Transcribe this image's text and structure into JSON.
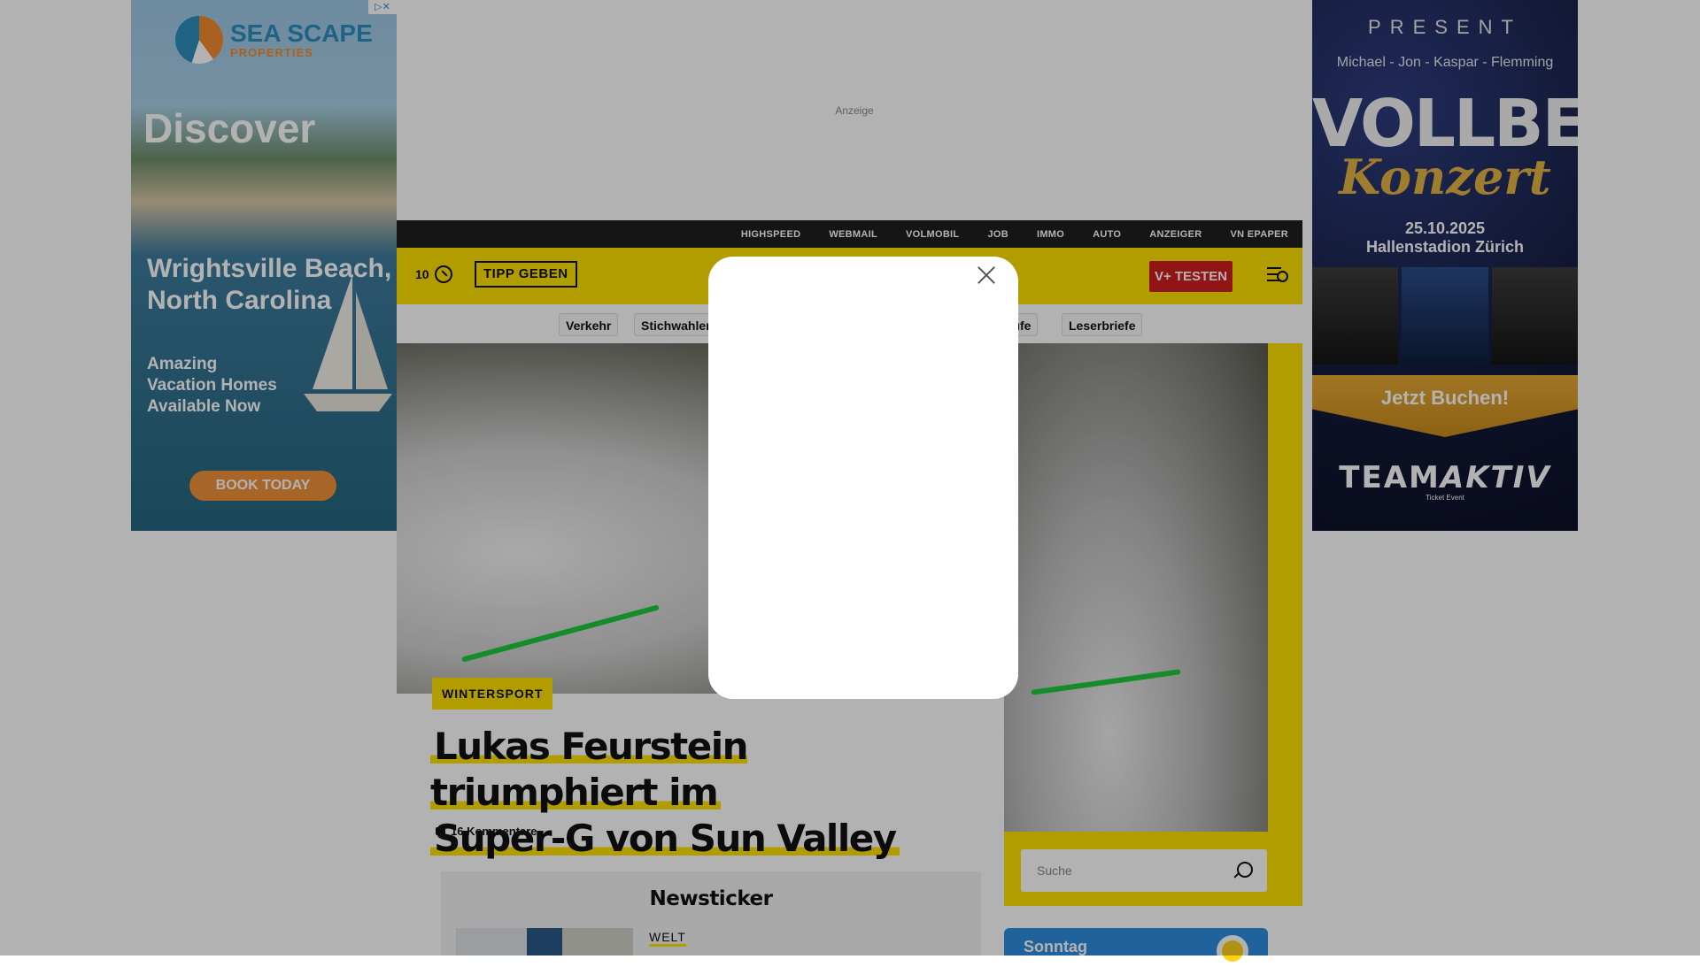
{
  "ads": {
    "left": {
      "brand": "SEA SCAPE",
      "brand_sub": "PROPERTIES",
      "headline": "Discover",
      "place": "Wrightsville Beach, North Carolina",
      "tagline": "Amazing Vacation Homes Available Now",
      "cta": "BOOK TODAY",
      "adchoices": "▷✕"
    },
    "right": {
      "present": "PRESENT",
      "names": "Michael -  Jon -  Kaspar - Flemming",
      "band": "VOLLBEAT",
      "event": "Konzert",
      "date": "25.10.2025",
      "venue": "Hallenstadion Zürich",
      "cta": "Jetzt Buchen!",
      "organizer_a": "TEAM",
      "organizer_b": "AKTIV",
      "organizer_sub": "Ticket Event"
    },
    "anzeige": "Anzeige"
  },
  "topnav": [
    "HIGHSPEED",
    "WEBMAIL",
    "VOLMOBIL",
    "JOB",
    "IMMO",
    "AUTO",
    "ANZEIGER",
    "VN EPAPER"
  ],
  "header": {
    "weather_count": "10",
    "tipp_label": "TIPP GEBEN",
    "vplus_label": "V+ TESTEN"
  },
  "tags": {
    "t1": "Verkehr",
    "t2": "Stichwahlen",
    "t3": "rufe",
    "t4": "Leserbriefe"
  },
  "article": {
    "kicker": "WINTERSPORT",
    "headline_line1": "Lukas Feurstein triumphiert im",
    "headline_line2": "Super-G von Sun Valley",
    "comments": "16 Kommentare"
  },
  "search": {
    "placeholder": "Suche"
  },
  "newsticker": {
    "title": "Newsticker",
    "category": "WELT"
  },
  "weather_widget": {
    "label": "Sonntag"
  },
  "colors": {
    "brand_yellow": "#ffe100",
    "vplus_red": "#d21f1f",
    "topbar": "#1f1f1f"
  }
}
